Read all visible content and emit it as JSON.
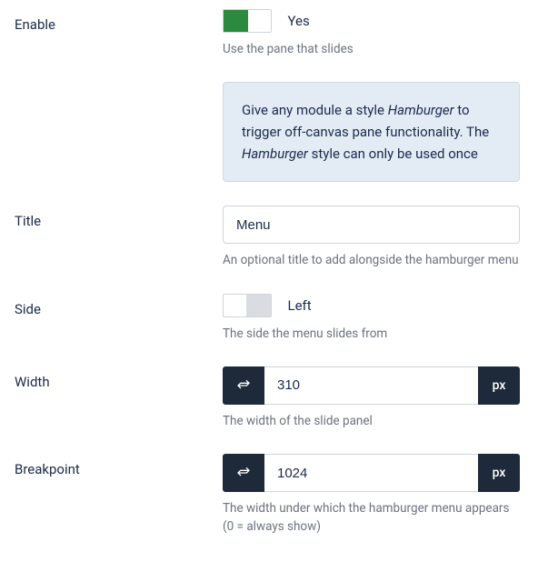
{
  "fields": {
    "enable": {
      "label": "Enable",
      "value_label": "Yes",
      "help": "Use the pane that slides"
    },
    "info": {
      "text_pre": "Give any module a style ",
      "em1": "Hamburger",
      "mid": " to trigger off-canvas pane functionality. The ",
      "em2": "Hamburger",
      "post": " style can only be used once"
    },
    "title": {
      "label": "Title",
      "value": "Menu",
      "help": "An optional title to add alongside the hamburger menu"
    },
    "side": {
      "label": "Side",
      "value_label": "Left",
      "help": "The side the menu slides from"
    },
    "width": {
      "label": "Width",
      "value": "310",
      "unit": "px",
      "help": "The width of the slide panel"
    },
    "breakpoint": {
      "label": "Breakpoint",
      "value": "1024",
      "unit": "px",
      "help": "The width under which the hamburger menu appears (0 = always show)"
    }
  }
}
